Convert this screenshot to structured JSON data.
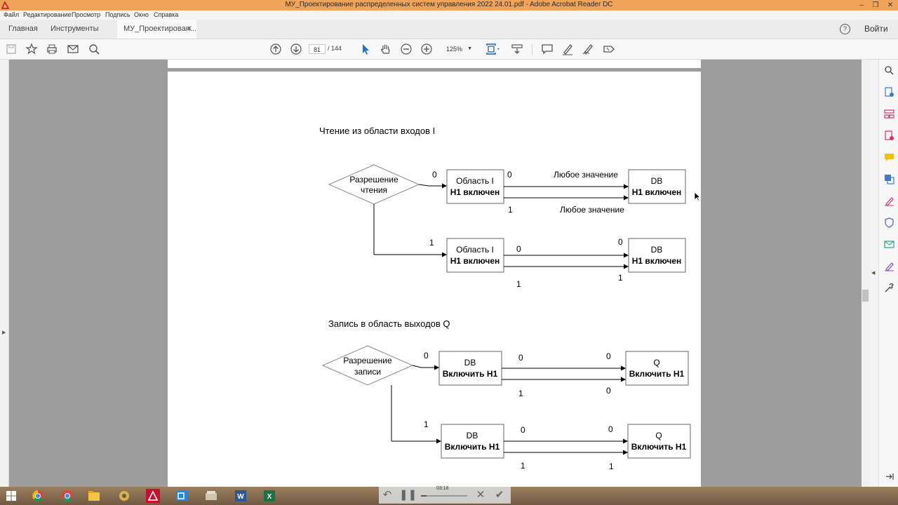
{
  "window": {
    "title": "МУ_Проектирование распределенных систем управления 2022 24.01.pdf - Adobe Acrobat Reader DC",
    "minimize": "–",
    "maximize": "❐",
    "close": "✕"
  },
  "menu": {
    "items": [
      "Файл",
      "Редактирование",
      "Просмотр",
      "Подпись",
      "Окно",
      "Справка"
    ]
  },
  "tabs": {
    "home": "Главная",
    "tools": "Инструменты",
    "document": "МУ_Проектирован...",
    "close": "✕",
    "help": "?",
    "signin": "Войти"
  },
  "toolbar": {
    "page_current": "81",
    "page_total": "/  144",
    "zoom": "125%",
    "zoom_arrow": "▼"
  },
  "document": {
    "section_read": {
      "heading": "Чтение из области входов  I",
      "diamond": [
        "Разрешение",
        "чтения"
      ],
      "box_area_line1": "Область I",
      "box_area_line2": "Н1 включен",
      "box_db_line1": "DB",
      "box_db_line2": "Н1 включен",
      "any_value": "Любое значение",
      "zero": "0",
      "one": "1"
    },
    "section_write": {
      "heading": "Запись в область выходов Q",
      "diamond": [
        "Разрешение",
        "записи"
      ],
      "box_db_line1": "DB",
      "box_db_line2": "Включить Н1",
      "box_q_line1": "Q",
      "box_q_line2": "Включить Н1",
      "zero": "0",
      "one": "1"
    }
  },
  "player": {
    "time": "03:18",
    "progress": 0.12
  },
  "taskbar": {
    "items": [
      "windows-start",
      "chrome",
      "chrome-alt",
      "file-explorer",
      "settings",
      "acrobat",
      "outlook",
      "files",
      "word",
      "excel"
    ]
  },
  "colors": {
    "titlebar": "#efa45a",
    "accent_red": "#c8102e",
    "panel_pink": "#d6336c"
  }
}
